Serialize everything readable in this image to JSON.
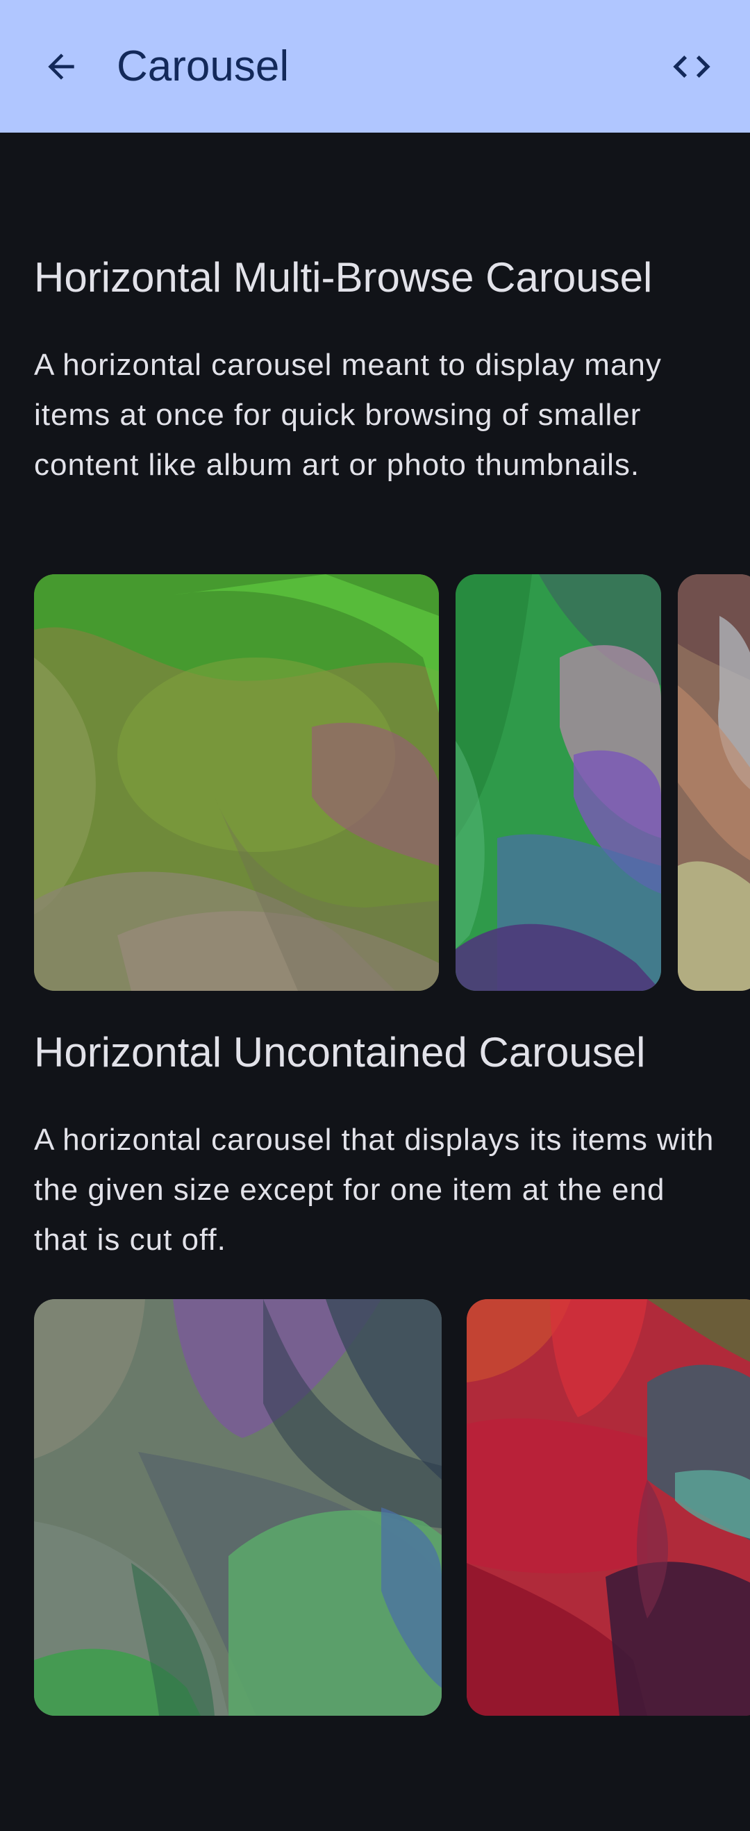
{
  "app_bar": {
    "title": "Carousel",
    "back_icon": "arrow-back-icon",
    "code_icon": "code-icon",
    "background": "#b0c6ff",
    "foreground": "#13295a"
  },
  "sections": [
    {
      "title": "Horizontal Multi-Browse Carousel",
      "description": "A horizontal carousel meant to display many items at once for quick browsing of smaller content like album art or photo thumbnails."
    },
    {
      "title": "Horizontal Uncontained Carousel",
      "description": "A horizontal carousel that displays its items with the given size except for one item at the end that is cut off."
    }
  ],
  "colors": {
    "background": "#111318",
    "text": "#e2e2e9"
  }
}
